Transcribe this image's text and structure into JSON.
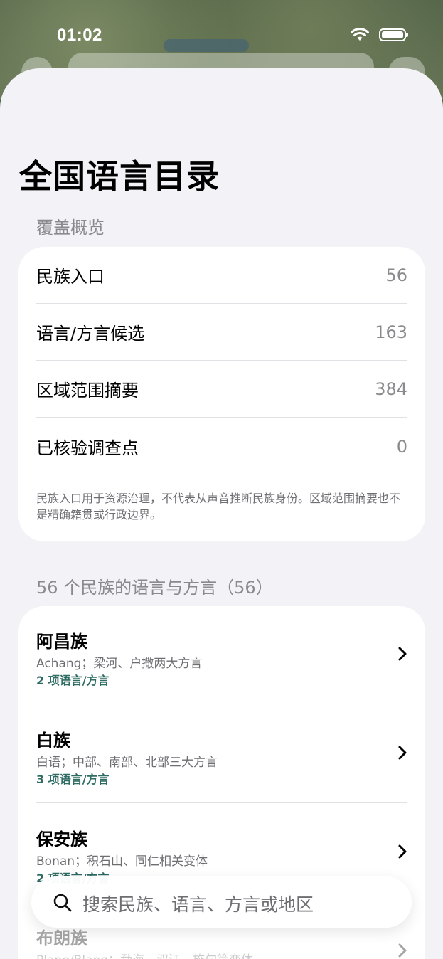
{
  "status_bar": {
    "time": "01:02"
  },
  "header": {
    "title": "全国语言目录"
  },
  "overview": {
    "section_title": "覆盖概览",
    "stats": [
      {
        "label": "民族入口",
        "value": "56"
      },
      {
        "label": "语言/方言候选",
        "value": "163"
      },
      {
        "label": "区域范围摘要",
        "value": "384"
      },
      {
        "label": "已核验调查点",
        "value": "0"
      }
    ],
    "note": "民族入口用于资源治理，不代表从声音推断民族身份。区域范围摘要也不是精确籍贯或行政边界。"
  },
  "ethnic_list": {
    "section_title": "56 个民族的语言与方言（56）",
    "items": [
      {
        "name": "阿昌族",
        "desc": "Achang；梁河、户撒两大方言",
        "count": "2 项语言/方言"
      },
      {
        "name": "白族",
        "desc": "白语；中部、南部、北部三大方言",
        "count": "3 项语言/方言"
      },
      {
        "name": "保安族",
        "desc": "Bonan；积石山、同仁相关变体",
        "count": "2 项语言/方言"
      },
      {
        "name": "布朗族",
        "desc": "Plang/Blang；勐海、双江、施甸等变体",
        "count": ""
      }
    ]
  },
  "search": {
    "placeholder": "搜索民族、语言、方言或地区"
  }
}
